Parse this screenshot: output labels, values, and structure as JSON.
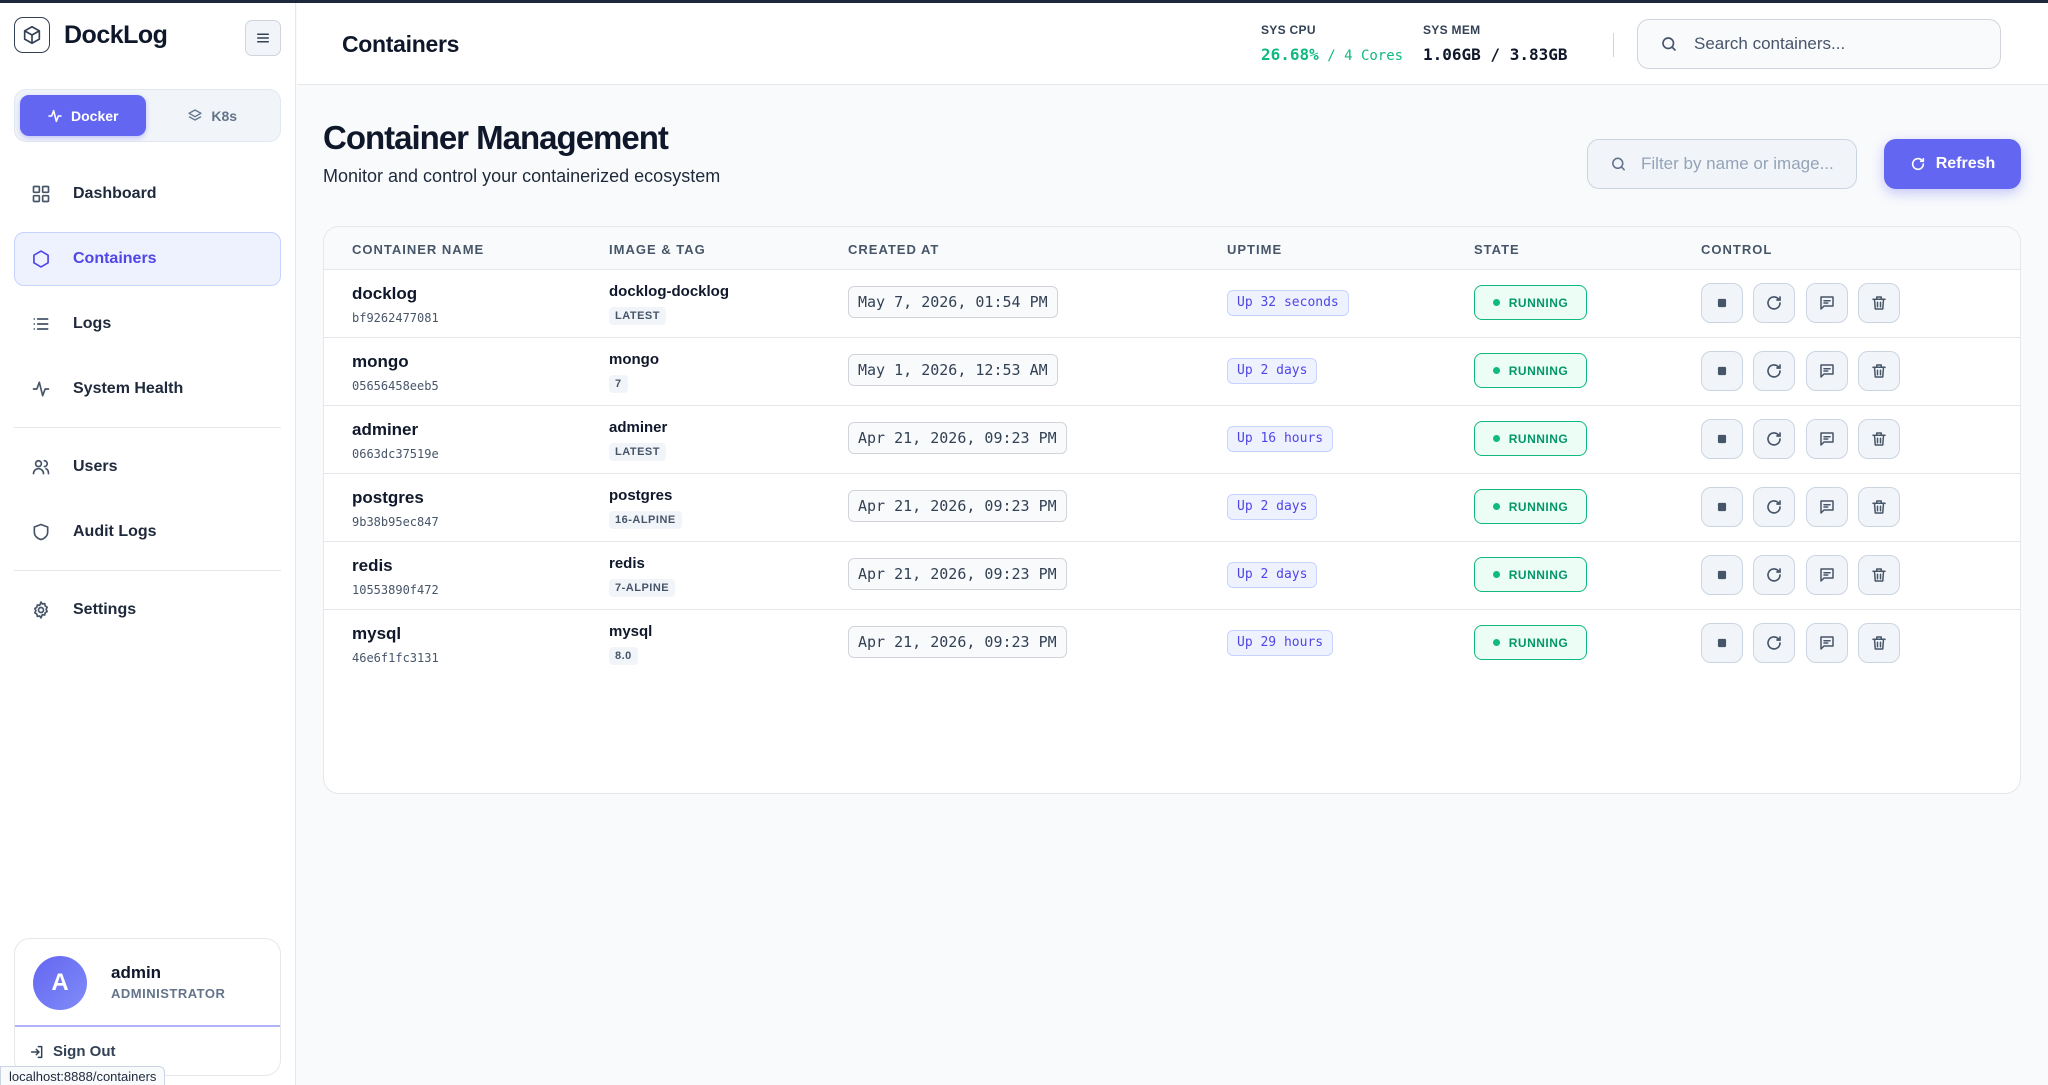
{
  "brand": {
    "name": "DockLog"
  },
  "modes": [
    {
      "label": "Docker",
      "active": true
    },
    {
      "label": "K8s",
      "active": false
    }
  ],
  "nav": {
    "items": [
      {
        "label": "Dashboard",
        "icon": "grid-icon"
      },
      {
        "label": "Containers",
        "icon": "hexagon-icon",
        "active": true
      },
      {
        "label": "Logs",
        "icon": "list-icon"
      },
      {
        "label": "System Health",
        "icon": "activity-icon"
      },
      {
        "label": "Users",
        "icon": "users-icon"
      },
      {
        "label": "Audit Logs",
        "icon": "shield-icon"
      },
      {
        "label": "Settings",
        "icon": "gear-icon"
      }
    ]
  },
  "user": {
    "initial": "A",
    "name": "admin",
    "role": "ADMINISTRATOR",
    "sign_out": "Sign Out"
  },
  "status_bar": {
    "url": "localhost:8888/containers"
  },
  "topbar": {
    "title": "Containers",
    "cpu": {
      "label": "SYS CPU",
      "value": "26.68%",
      "sub": " / 4 Cores"
    },
    "mem": {
      "label": "SYS MEM",
      "value": "1.06GB / 3.83GB"
    },
    "search_placeholder": "Search containers..."
  },
  "main": {
    "heading": "Container Management",
    "subtitle": "Monitor and control your containerized ecosystem",
    "filter_placeholder": "Filter by name or image...",
    "refresh_label": "Refresh"
  },
  "table": {
    "headers": {
      "name": "CONTAINER NAME",
      "image": "IMAGE & TAG",
      "created": "CREATED AT",
      "uptime": "UPTIME",
      "state": "STATE",
      "control": "CONTROL"
    },
    "rows": [
      {
        "name": "docklog",
        "id": "bf9262477081",
        "image": "docklog-docklog",
        "tag": "LATEST",
        "created": "May 7, 2026, 01:54 PM",
        "uptime": "Up 32 seconds",
        "state": "RUNNING"
      },
      {
        "name": "mongo",
        "id": "05656458eeb5",
        "image": "mongo",
        "tag": "7",
        "created": "May 1, 2026, 12:53 AM",
        "uptime": "Up 2 days",
        "state": "RUNNING"
      },
      {
        "name": "adminer",
        "id": "0663dc37519e",
        "image": "adminer",
        "tag": "LATEST",
        "created": "Apr 21, 2026, 09:23 PM",
        "uptime": "Up 16 hours",
        "state": "RUNNING"
      },
      {
        "name": "postgres",
        "id": "9b38b95ec847",
        "image": "postgres",
        "tag": "16-ALPINE",
        "created": "Apr 21, 2026, 09:23 PM",
        "uptime": "Up 2 days",
        "state": "RUNNING"
      },
      {
        "name": "redis",
        "id": "10553890f472",
        "image": "redis",
        "tag": "7-ALPINE",
        "created": "Apr 21, 2026, 09:23 PM",
        "uptime": "Up 2 days",
        "state": "RUNNING"
      },
      {
        "name": "mysql",
        "id": "46e6f1fc3131",
        "image": "mysql",
        "tag": "8.0",
        "created": "Apr 21, 2026, 09:23 PM",
        "uptime": "Up 29 hours",
        "state": "RUNNING"
      }
    ]
  },
  "colors": {
    "accent": "#6366f1",
    "running": "#10b981"
  }
}
